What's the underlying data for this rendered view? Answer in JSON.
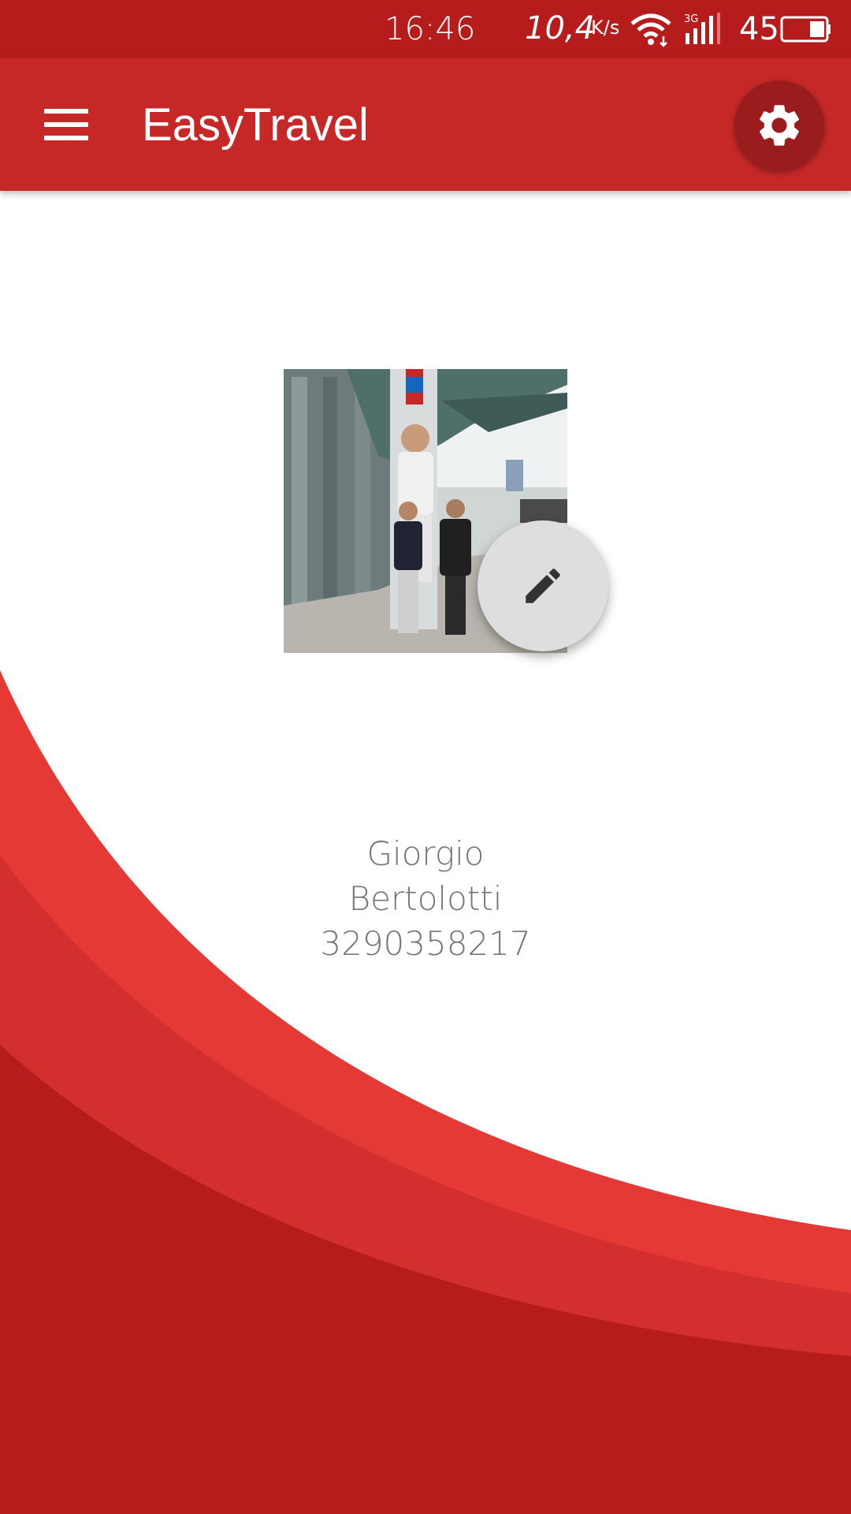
{
  "status_bar": {
    "time": "16:46",
    "net_speed": "10,4",
    "net_unit": "K/s",
    "network_type": "3G",
    "battery_level": "45"
  },
  "app_bar": {
    "title": "EasyTravel",
    "menu_icon": "hamburger-menu-icon",
    "settings_icon": "gear-icon"
  },
  "profile": {
    "first_name": "Giorgio",
    "last_name": "Bertolotti",
    "phone": "3290358217",
    "edit_icon": "pencil-icon"
  },
  "colors": {
    "status_bar": "#b71c1c",
    "app_bar": "#c62828",
    "settings_button": "#9b1c1c",
    "wave_light": "#e53935",
    "wave_mid": "#d32f2f",
    "wave_dark": "#b71c1c",
    "fab": "#dedede",
    "text_secondary": "#757575"
  }
}
